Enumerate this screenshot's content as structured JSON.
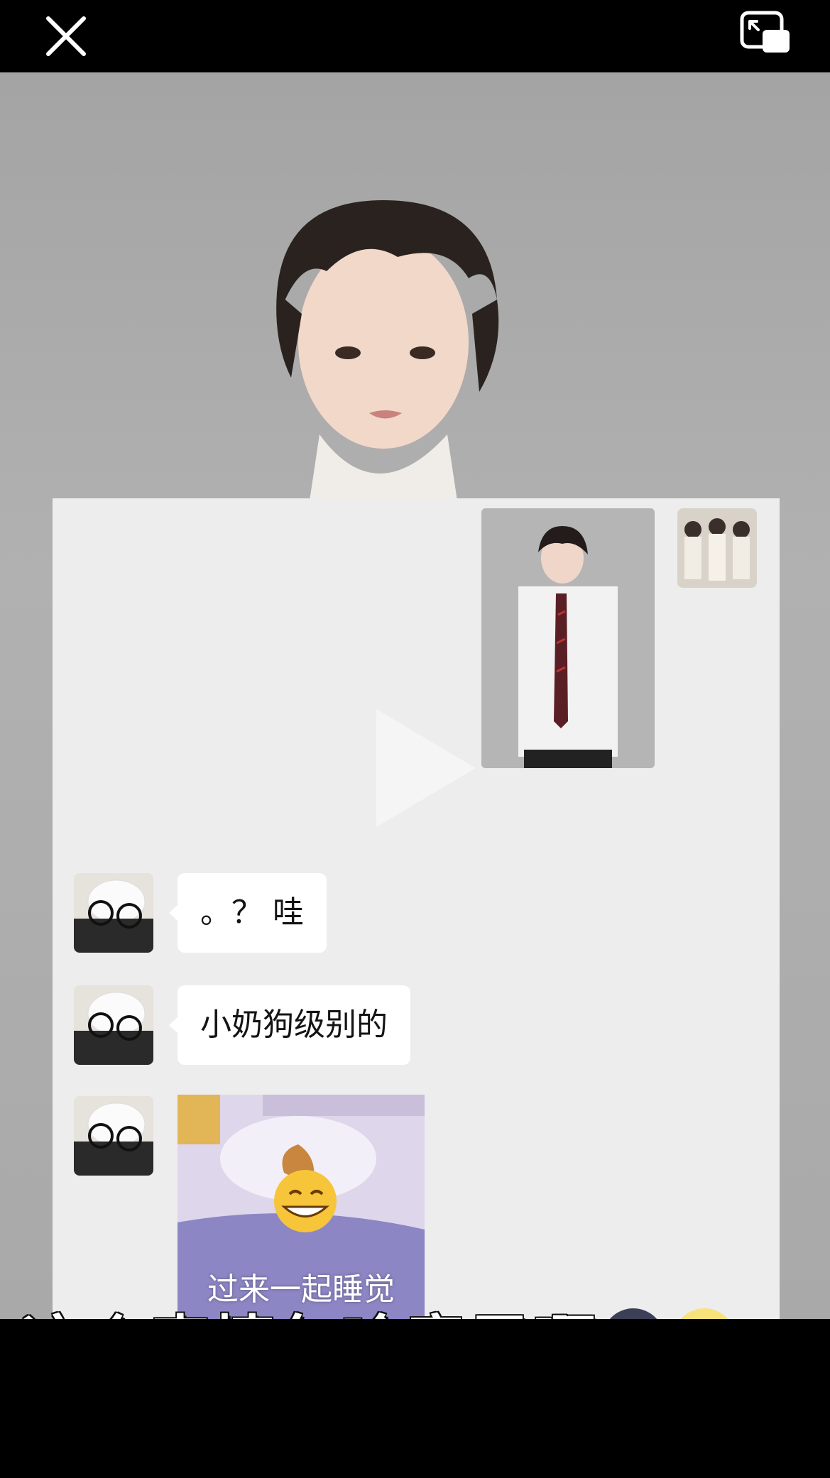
{
  "topbar": {
    "close_icon": "close-icon",
    "pip_icon": "picture-in-picture-icon"
  },
  "chat": {
    "messages": [
      {
        "sender": "other",
        "text": "。？ 哇"
      },
      {
        "sender": "other",
        "text": "小奶狗级别的"
      },
      {
        "sender": "other",
        "type": "sticker",
        "caption": "过来一起睡觉"
      }
    ]
  },
  "subtitle": {
    "text": "这个表情包啥意思啊",
    "emojis": [
      "new-moon-face",
      "full-moon-face"
    ]
  },
  "colors": {
    "background": "#000000",
    "chat_bg": "#ededed",
    "bubble": "#ffffff",
    "video_bg": "#a9a9a9"
  }
}
